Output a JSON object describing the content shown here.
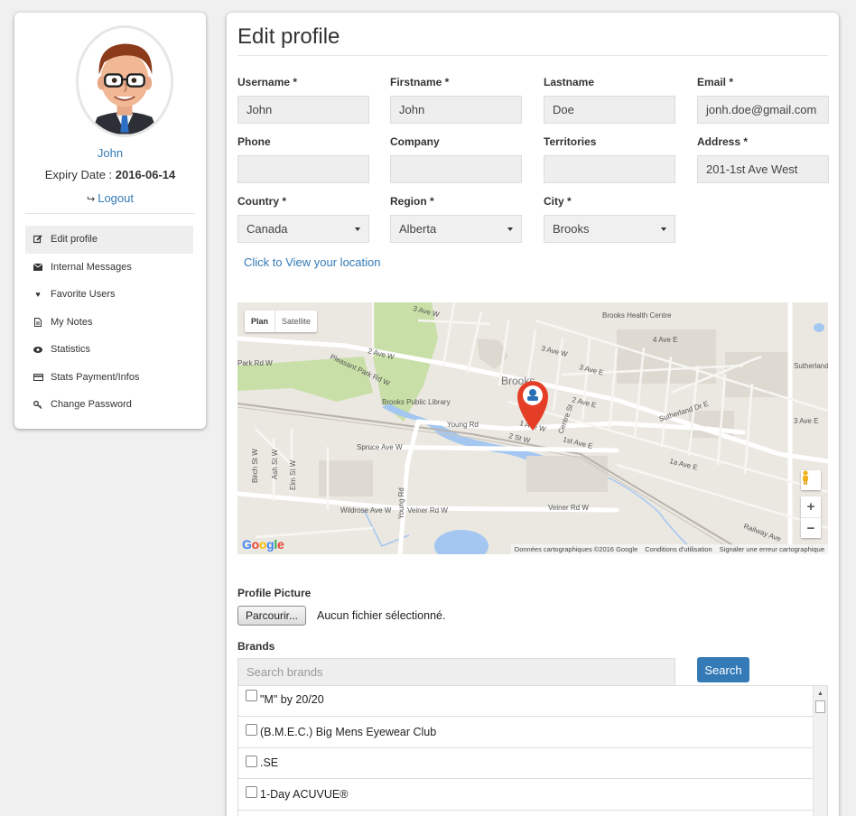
{
  "sidebar": {
    "name": "John",
    "expiry_label": "Expiry Date : ",
    "expiry_value": "2016-06-14",
    "logout": "Logout",
    "menu": [
      {
        "label": "Edit profile",
        "icon": "edit-icon",
        "active": true
      },
      {
        "label": "Internal Messages",
        "icon": "envelope-icon"
      },
      {
        "label": "Favorite Users",
        "icon": "heart-icon"
      },
      {
        "label": "My Notes",
        "icon": "file-icon"
      },
      {
        "label": "Statistics",
        "icon": "eye-icon"
      },
      {
        "label": "Stats Payment/Infos",
        "icon": "credit-card-icon"
      },
      {
        "label": "Change Password",
        "icon": "key-icon"
      }
    ]
  },
  "main": {
    "title": "Edit profile",
    "fields": {
      "username": {
        "label": "Username *",
        "value": "John"
      },
      "firstname": {
        "label": "Firstname *",
        "value": "John"
      },
      "lastname": {
        "label": "Lastname",
        "value": "Doe"
      },
      "email": {
        "label": "Email *",
        "value": "jonh.doe@gmail.com"
      },
      "phone": {
        "label": "Phone",
        "value": ""
      },
      "company": {
        "label": "Company",
        "value": ""
      },
      "territories": {
        "label": "Territories",
        "value": ""
      },
      "address": {
        "label": "Address *",
        "value": "201-1st Ave West"
      },
      "country": {
        "label": "Country *",
        "value": "Canada"
      },
      "region": {
        "label": "Region *",
        "value": "Alberta"
      },
      "city": {
        "label": "City *",
        "value": "Brooks"
      }
    },
    "view_location": "Click to View your location",
    "map": {
      "type_plan": "Plan",
      "type_satellite": "Satellite",
      "footer": [
        "Données cartographiques ©2016 Google",
        "Conditions d'utilisation",
        "Signaler une erreur cartographique"
      ],
      "places": {
        "brooks_health_centre": "Brooks Health Centre",
        "brooks_public_library": "Brooks Public Library",
        "brooks": "Brooks",
        "sutherland": "Sutherland",
        "pleasant_park": "Pleasant Park Rd W",
        "park_rd": "Park Rd W",
        "young_rd": "Young Rd",
        "spruce_ave": "Spruce Ave W",
        "wildrose_ave": "Wildrose Ave W",
        "veiner_rd": "Veiner Rd W",
        "railway_ave": "Railway Ave",
        "sutherland_dr": "Sutherland Dr E",
        "ave_2_w": "2 Ave W",
        "ave_3_w": "3 Ave W",
        "ave_2_e": "2 Ave E",
        "ave_3_e": "3 Ave E",
        "ave_4_e": "4 Ave E",
        "ave_1_w": "1 Ave W",
        "ave_1st_e": "1st Ave E",
        "ave_1a_e": "1a Ave E",
        "st_2_w": "2 St W",
        "centre_st": "Centre St",
        "birch_st": "Birch St W",
        "ash_st": "Ash St W",
        "elm_st": "Elm St W",
        "young_rd_v": "Young Rd"
      },
      "google": [
        "G",
        "o",
        "o",
        "g",
        "l",
        "e"
      ]
    },
    "profile_picture_label": "Profile Picture",
    "file_button": "Parcourir...",
    "file_status": "Aucun fichier sélectionné.",
    "brands_label": "Brands",
    "brands_search_placeholder": "Search brands",
    "search_button": "Search",
    "brands": [
      "\"M\" by 20/20",
      "(B.M.E.C.) Big Mens Eyewear Club",
      ".SE",
      "1-Day ACUVUE®",
      ""
    ]
  },
  "colors": {
    "link": "#337ab7",
    "button": "#337ab7",
    "marker": "#e53e26",
    "park": "#c8dfa7",
    "water": "#a4c7f2"
  }
}
